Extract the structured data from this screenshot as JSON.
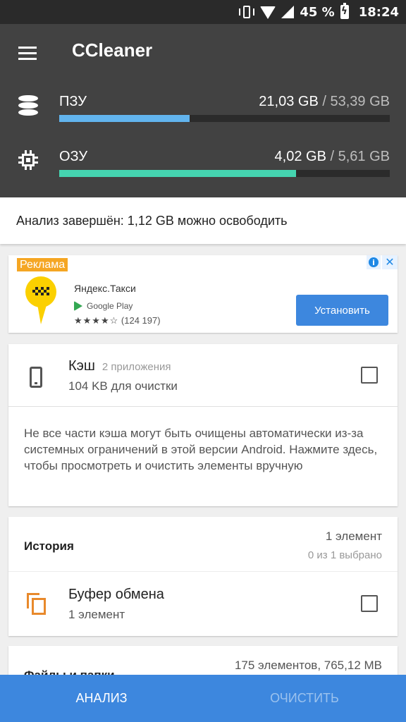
{
  "status_bar": {
    "battery": "45 %",
    "time": "18:24"
  },
  "app": {
    "title": "CCleaner"
  },
  "memory": {
    "rom": {
      "label": "ПЗУ",
      "used": "21,03 GB",
      "sep": "/",
      "total": "53,39 GB",
      "fraction": 0.394,
      "color": "#62b4ee"
    },
    "ram": {
      "label": "ОЗУ",
      "used": "4,02 GB",
      "sep": "/",
      "total": "5,61 GB",
      "fraction": 0.717,
      "color": "#45d4b0"
    }
  },
  "summary": {
    "text": "Анализ завершён: 1,12 GB можно освободить"
  },
  "ad": {
    "badge": "Реклама",
    "info": "i",
    "close": "✕",
    "app_name": "Яндекс.Такси",
    "store": "Google Play",
    "stars": "★★★★☆",
    "reviews": "(124 197)",
    "install_label": "Установить"
  },
  "cache_card": {
    "title": "Кэш",
    "apps": "2 приложения",
    "size": "104 KB для очистки",
    "note": "Не все части кэша могут быть очищены автоматически из-за системных ограничений в этой версии Android. Нажмите здесь, чтобы просмотреть и очистить элементы вручную"
  },
  "history_card": {
    "title": "История",
    "count": "1 элемент",
    "selected": "0 из 1 выбрано",
    "clipboard": {
      "title": "Буфер обмена",
      "count": "1 элемент"
    }
  },
  "files_card": {
    "title": "Файлы и папки",
    "count": "175 элементов, 765,12 MB"
  },
  "bottom_bar": {
    "analyze": "АНАЛИЗ",
    "clean": "ОЧИСТИТЬ"
  },
  "colors": {
    "accent": "#3d87de",
    "header": "#424242",
    "clipboard_icon": "#e8892b"
  }
}
